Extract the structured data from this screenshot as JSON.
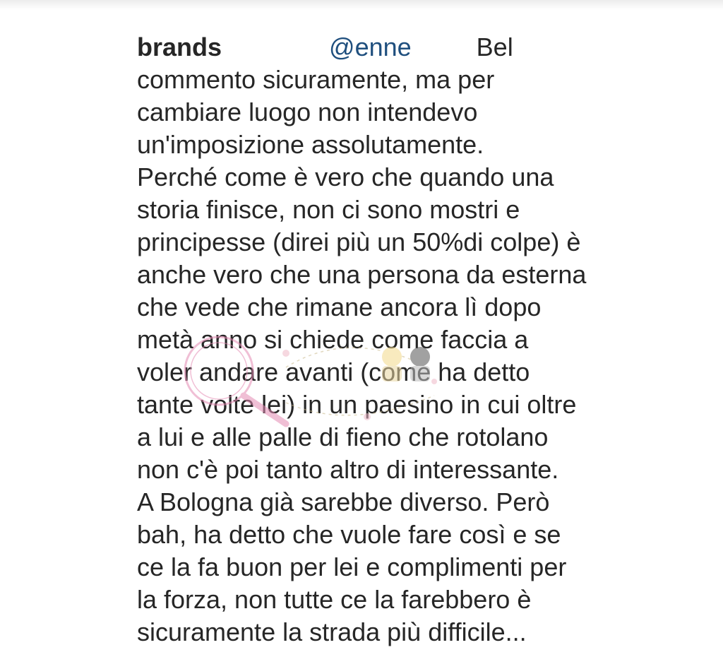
{
  "comment": {
    "username": "brands",
    "mention": "@enne",
    "first_word": "Bel",
    "lines": [
      "commento sicuramente, ma per",
      "cambiare luogo non intendevo",
      "un'imposizione assolutamente.",
      "Perché come è vero che quando una",
      "storia finisce, non ci sono mostri e",
      "principesse (direi più un 50%di colpe) è",
      "anche vero che una persona da esterna",
      "che vede che rimane ancora lì dopo",
      "metà anno si chiede come faccia a",
      "voler andare avanti (come ha detto",
      "tante volte lei) in un paesino in cui oltre",
      "a lui e alle palle di fieno che rotolano",
      "non c'è poi tanto altro di interessante.",
      "A Bologna già sarebbe diverso. Però",
      "bah, ha detto che vuole fare così e se",
      "ce la fa buon per lei e complimenti per",
      "la forza, non tutte ce la farebbero è",
      "sicuramente la strada più difficile..."
    ]
  },
  "watermark": {
    "icon": "magnifier-logo-icon",
    "color": "#e58bb4"
  }
}
